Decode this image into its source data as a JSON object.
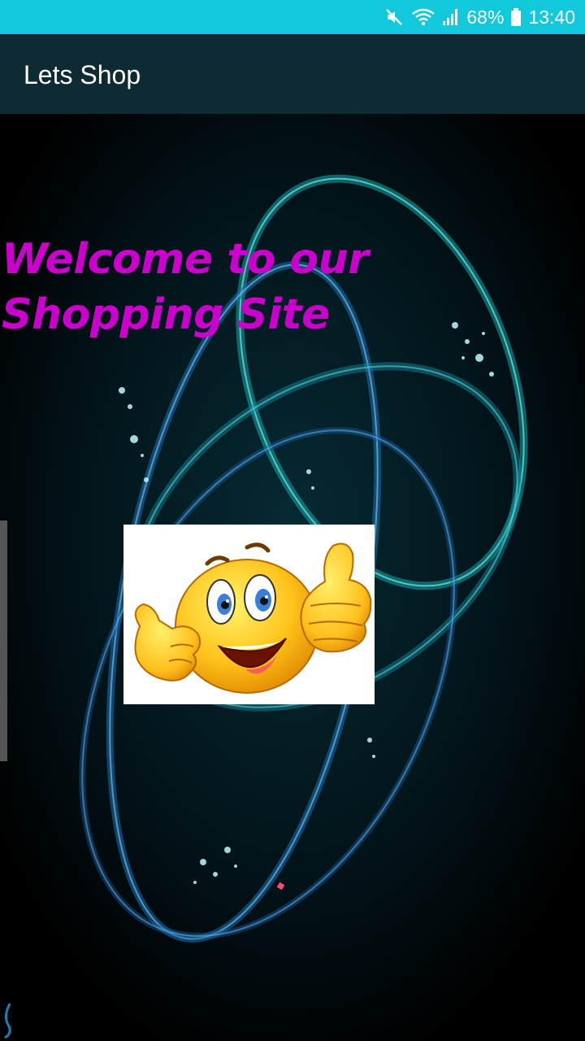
{
  "status_bar": {
    "battery": "68%",
    "time": "13:40",
    "icons": [
      "mute-icon",
      "wifi-icon",
      "signal-icon",
      "battery-icon"
    ],
    "background": "#12c9dc"
  },
  "app_bar": {
    "title": "Lets Shop",
    "background": "#0e2b33"
  },
  "main": {
    "welcome_text": "Welcome to our Shopping Site",
    "welcome_color": "#cc00cc",
    "image_icon": "smiley-thumbs-up-icon"
  }
}
